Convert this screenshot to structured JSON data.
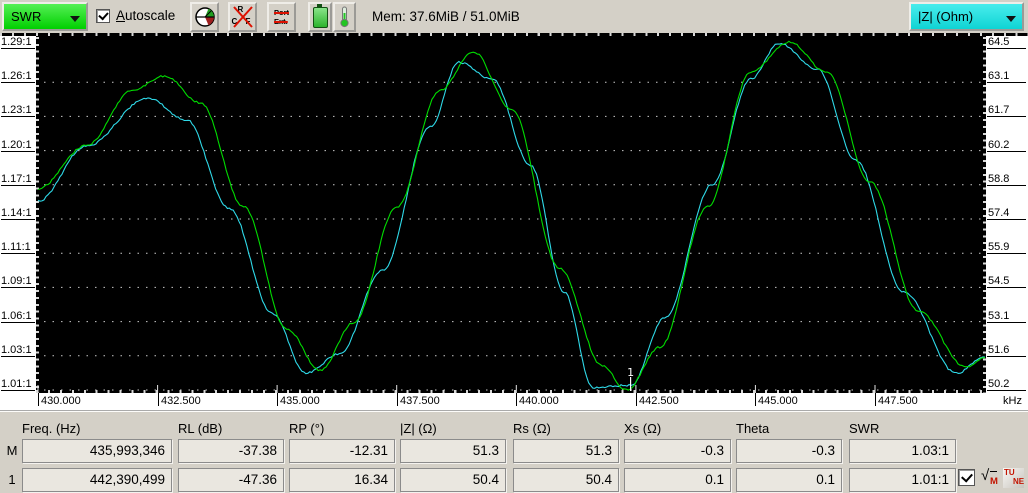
{
  "toolbar": {
    "trace_selector": {
      "value": "SWR",
      "color": "#22e022"
    },
    "autoscale": {
      "mnemonic": "A",
      "rest": "utoscale",
      "checked": true
    },
    "icons": {
      "rcf": {
        "l1": "R",
        "l2": "C",
        "l3": "F"
      },
      "port_ext": {
        "line1": "Port",
        "line2": "Ext."
      }
    },
    "mem": "Mem: 37.6MiB / 51.0MiB",
    "right_selector": {
      "value": "|Z| (Ohm)",
      "color": "#1fe1e1"
    }
  },
  "chart_data": {
    "type": "line",
    "background": "#000000",
    "grid": "horizontal-dotted",
    "x_axis": {
      "label": "kHz",
      "ticks": [
        "430.000",
        "432.500",
        "435.000",
        "437.500",
        "440.000",
        "442.500",
        "445.000",
        "447.500"
      ],
      "tick_values": [
        430,
        432.5,
        435,
        437.5,
        440,
        442.5,
        445,
        447.5
      ],
      "range": [
        430,
        449.8
      ]
    },
    "y_left_axis": {
      "name": "SWR",
      "ticks": [
        "1.29:1",
        "1.26:1",
        "1.23:1",
        "1.20:1",
        "1.17:1",
        "1.14:1",
        "1.11:1",
        "1.09:1",
        "1.06:1",
        "1.03:1",
        "1.01:1"
      ],
      "top_value": 1.29,
      "bottom_value": 1.01
    },
    "y_right_axis": {
      "name": "|Z| (Ohm)",
      "ticks": [
        "64.5",
        "63.1",
        "61.7",
        "60.2",
        "58.8",
        "57.4",
        "55.9",
        "54.5",
        "53.1",
        "51.6",
        "50.2"
      ],
      "top_value": 64.5,
      "bottom_value": 50.2
    },
    "series": [
      {
        "name": "|Z|",
        "axis": "right",
        "color": "#2fd9e8",
        "points": [
          [
            430.0,
            58.1
          ],
          [
            431.0,
            60.4
          ],
          [
            432.3,
            62.4
          ],
          [
            433.1,
            61.5
          ],
          [
            434.0,
            57.8
          ],
          [
            434.9,
            53.4
          ],
          [
            435.6,
            50.9
          ],
          [
            436.3,
            51.7
          ],
          [
            437.2,
            55.2
          ],
          [
            438.2,
            61.2
          ],
          [
            438.8,
            63.9
          ],
          [
            439.5,
            63.2
          ],
          [
            440.3,
            59.6
          ],
          [
            441.0,
            54.3
          ],
          [
            441.6,
            50.3
          ],
          [
            442.4,
            50.4
          ],
          [
            443.1,
            53.2
          ],
          [
            444.1,
            58.8
          ],
          [
            444.9,
            63.2
          ],
          [
            445.5,
            64.7
          ],
          [
            446.3,
            63.6
          ],
          [
            447.1,
            59.8
          ],
          [
            448.1,
            54.3
          ],
          [
            449.2,
            50.9
          ],
          [
            449.8,
            51.6
          ]
        ]
      },
      {
        "name": "SWR",
        "axis": "left",
        "color": "#00dc00",
        "points": [
          [
            430.0,
            1.175
          ],
          [
            431.0,
            1.21
          ],
          [
            432.0,
            1.256
          ],
          [
            432.65,
            1.267
          ],
          [
            433.4,
            1.245
          ],
          [
            434.3,
            1.16
          ],
          [
            435.2,
            1.06
          ],
          [
            435.9,
            1.026
          ],
          [
            436.6,
            1.065
          ],
          [
            437.5,
            1.16
          ],
          [
            438.4,
            1.255
          ],
          [
            439.1,
            1.287
          ],
          [
            439.9,
            1.24
          ],
          [
            440.9,
            1.11
          ],
          [
            441.8,
            1.03
          ],
          [
            442.3,
            1.01
          ],
          [
            443.0,
            1.045
          ],
          [
            444.0,
            1.16
          ],
          [
            444.9,
            1.27
          ],
          [
            445.7,
            1.295
          ],
          [
            446.5,
            1.27
          ],
          [
            447.4,
            1.18
          ],
          [
            448.4,
            1.075
          ],
          [
            449.4,
            1.029
          ],
          [
            449.8,
            1.036
          ]
        ]
      }
    ],
    "marker": {
      "id": "1",
      "freq": 442.39,
      "color": "#ffffff"
    }
  },
  "table": {
    "headers": [
      "Freq. (Hz)",
      "RL (dB)",
      "RP (°)",
      "|Z| (Ω)",
      "Rs (Ω)",
      "Xs (Ω)",
      "Theta",
      "SWR"
    ],
    "rows": [
      {
        "label": "M",
        "values": [
          "435,993,346",
          "-37.38",
          "-12.31",
          "51.3",
          "51.3",
          "-0.3",
          "-0.3",
          "1.03:1"
        ]
      },
      {
        "label": "1",
        "values": [
          "442,390,499",
          "-47.36",
          "16.34",
          "50.4",
          "50.4",
          "0.1",
          "0.1",
          "1.01:1"
        ]
      }
    ]
  },
  "bottom_controls": {
    "checkbox_checked": true,
    "sqrt_symbol": "√",
    "sqrt_sub": "M",
    "tune_top": "TU",
    "tune_bottom": "NE"
  }
}
